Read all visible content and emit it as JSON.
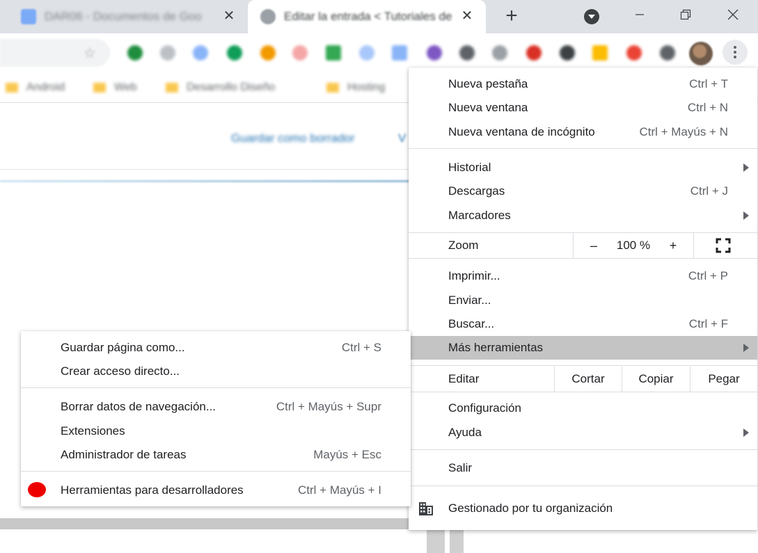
{
  "tabs": [
    {
      "title": "DAR06 - Documentos de Goo"
    },
    {
      "title": "Editar la entrada < Tutoriales de"
    }
  ],
  "tab_close_glyph": "✕",
  "new_tab_glyph": "+",
  "bookmarks": [
    "Android",
    "Web",
    "Desarrollo Diseño",
    "Hosting"
  ],
  "page": {
    "save_draft": "Guardar como borrador",
    "letter": "V"
  },
  "main_menu": {
    "new_tab": {
      "label": "Nueva pestaña",
      "shortcut": "Ctrl + T"
    },
    "new_window": {
      "label": "Nueva ventana",
      "shortcut": "Ctrl + N"
    },
    "incognito": {
      "label": "Nueva ventana de incógnito",
      "shortcut": "Ctrl + Mayús + N"
    },
    "history": {
      "label": "Historial"
    },
    "downloads": {
      "label": "Descargas",
      "shortcut": "Ctrl + J"
    },
    "bookmarks": {
      "label": "Marcadores"
    },
    "zoom": {
      "label": "Zoom",
      "minus": "–",
      "value": "100 %",
      "plus": "+"
    },
    "print": {
      "label": "Imprimir...",
      "shortcut": "Ctrl + P"
    },
    "cast": {
      "label": "Enviar..."
    },
    "find": {
      "label": "Buscar...",
      "shortcut": "Ctrl + F"
    },
    "more_tools": {
      "label": "Más herramientas"
    },
    "edit": {
      "label": "Editar",
      "cut": "Cortar",
      "copy": "Copiar",
      "paste": "Pegar"
    },
    "settings": {
      "label": "Configuración"
    },
    "help": {
      "label": "Ayuda"
    },
    "exit": {
      "label": "Salir"
    },
    "managed": {
      "label": "Gestionado por tu organización"
    }
  },
  "sub_menu": {
    "save_page": {
      "label": "Guardar página como...",
      "shortcut": "Ctrl + S"
    },
    "create_shortcut": {
      "label": "Crear acceso directo..."
    },
    "clear_data": {
      "label": "Borrar datos de navegación...",
      "shortcut": "Ctrl + Mayús + Supr"
    },
    "extensions": {
      "label": "Extensiones"
    },
    "task_manager": {
      "label": "Administrador de tareas",
      "shortcut": "Mayús + Esc"
    },
    "devtools": {
      "label": "Herramientas para desarrolladores",
      "shortcut": "Ctrl + Mayús + I"
    }
  },
  "colors": {
    "highlight": "#c4c4c4",
    "devtools_marker": "#ee0000",
    "link_blue": "#2271b1"
  }
}
